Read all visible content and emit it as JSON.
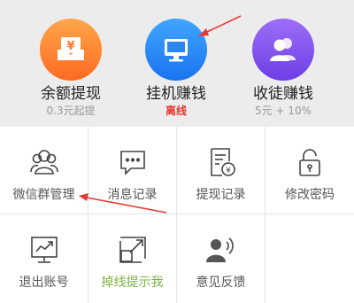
{
  "features": [
    {
      "title": "余额提现",
      "sub": "0.3元起提",
      "icon": "wallet-yen-icon",
      "color_top": "#ffa74a",
      "color_bottom": "#ff6a22"
    },
    {
      "title": "挂机赚钱",
      "sub": "离线",
      "icon": "monitor-icon",
      "color_top": "#40a6ff",
      "color_bottom": "#1a73f0"
    },
    {
      "title": "收徒赚钱",
      "sub": "5元 + 10%",
      "icon": "users-icon",
      "color_top": "#9c6ef7",
      "color_bottom": "#6d3fe6"
    }
  ],
  "grid": [
    {
      "label": "微信群管理",
      "icon": "wechat-group-icon"
    },
    {
      "label": "消息记录",
      "icon": "message-icon"
    },
    {
      "label": "提现记录",
      "icon": "receipt-yen-icon"
    },
    {
      "label": "修改密码",
      "icon": "lock-icon"
    },
    {
      "label": "退出账号",
      "icon": "exit-chart-icon"
    },
    {
      "label": "掉线提示我",
      "icon": "offline-alert-icon"
    },
    {
      "label": "意见反馈",
      "icon": "feedback-icon"
    }
  ],
  "colors": {
    "offline_red": "#e8352f",
    "green_label": "#7cb342",
    "arrow_red": "#e53935"
  }
}
